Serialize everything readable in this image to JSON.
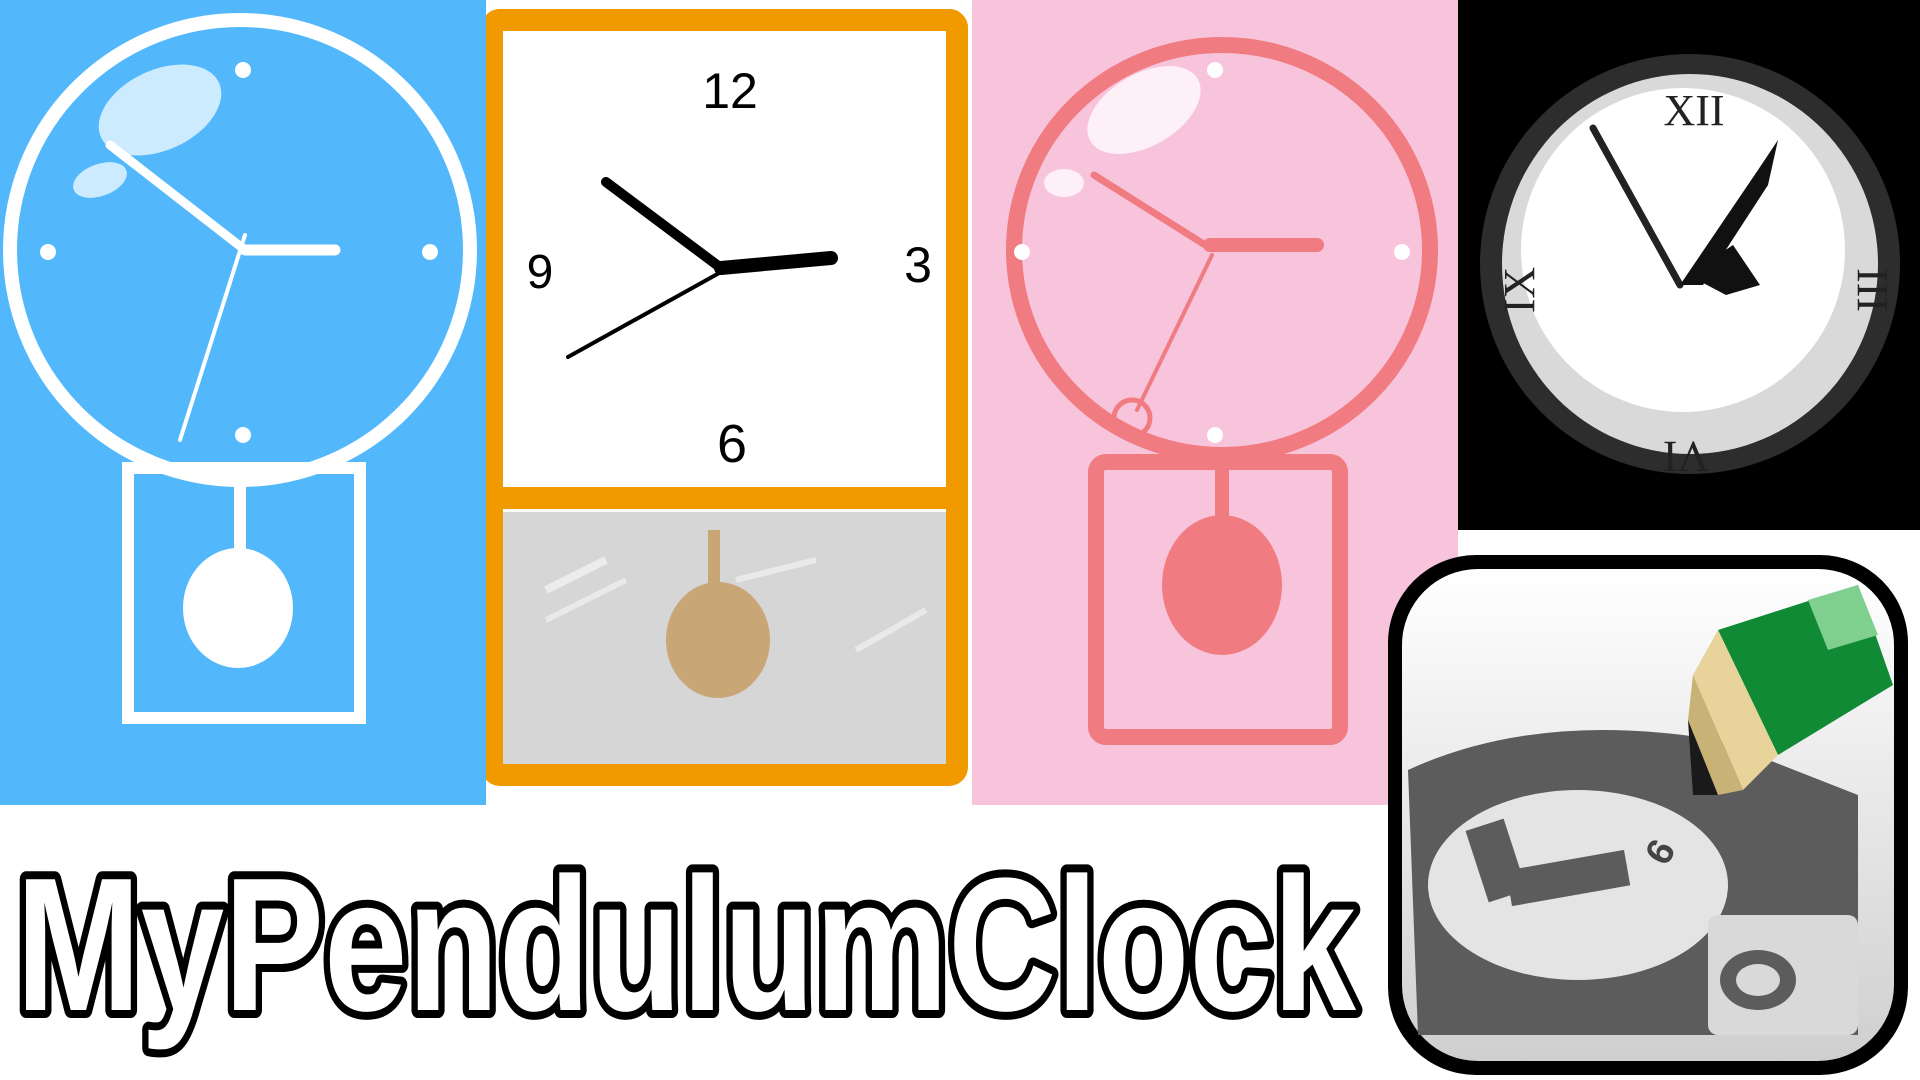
{
  "app_title": "MyPendulumClock",
  "orange_clock": {
    "numerals": [
      "12",
      "3",
      "6",
      "9"
    ]
  },
  "black_clock": {
    "numerals": [
      "XII",
      "III",
      "VI",
      "IX"
    ]
  },
  "app_icon": {
    "numeral": "6"
  },
  "colors": {
    "blue_panel": "#53b8fb",
    "orange_frame": "#f09a00",
    "pink_panel": "#f8c4dc",
    "pink_clock": "#f07b80",
    "black_panel": "#000000",
    "pencil_green": "#119b3c"
  }
}
